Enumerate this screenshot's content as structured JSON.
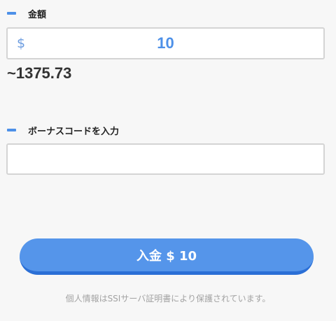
{
  "amount_section": {
    "label": "金額",
    "currency_symbol": "$",
    "value": "10",
    "converted": "~1375.73"
  },
  "bonus_section": {
    "label": "ボーナスコードを入力",
    "value": "",
    "placeholder": ""
  },
  "deposit_button": {
    "label": "入金 $ 10"
  },
  "security_note": "個人情報はSSIサーバ証明書により保護されています。",
  "colors": {
    "accent": "#4d90e8",
    "button": "#5595ea",
    "button_shadow": "#2b6fd6",
    "background": "#f7f7f7"
  }
}
